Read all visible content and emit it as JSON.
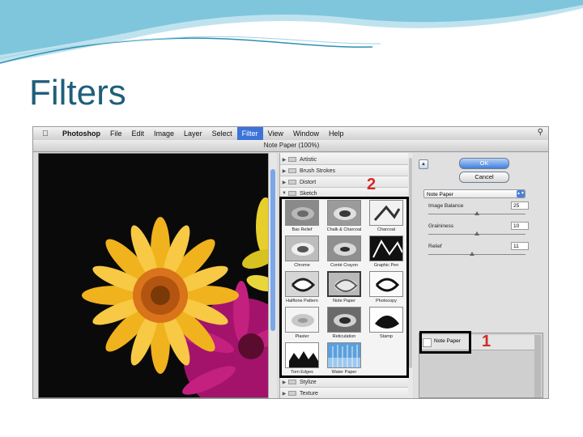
{
  "slide": {
    "title": "Filters"
  },
  "menubar": {
    "items": [
      "Photoshop",
      "File",
      "Edit",
      "Image",
      "Layer",
      "Select",
      "Filter",
      "View",
      "Window",
      "Help"
    ],
    "active": "Filter"
  },
  "dialog": {
    "title": "Note Paper (100%)"
  },
  "gallery": {
    "categories": [
      "Artistic",
      "Brush Strokes",
      "Distort",
      "Sketch",
      "Stylize",
      "Texture"
    ],
    "thumbnails": [
      "Bas Relief",
      "Chalk & Charcoal",
      "Charcoal",
      "Chrome",
      "Conté Crayon",
      "Graphic Pen",
      "Halftone Pattern",
      "Note Paper",
      "Photocopy",
      "Plaster",
      "Reticulation",
      "Stamp",
      "Torn Edges",
      "Water Paper"
    ],
    "selected": "Note Paper"
  },
  "settings": {
    "ok": "OK",
    "cancel": "Cancel",
    "filter": "Note Paper",
    "params": [
      {
        "label": "Image Balance",
        "value": "25",
        "fraction": 0.5
      },
      {
        "label": "Graininess",
        "value": "10",
        "fraction": 0.5
      },
      {
        "label": "Relief",
        "value": "11",
        "fraction": 0.45
      }
    ]
  },
  "layers": {
    "item": "Note Paper"
  },
  "annotations": {
    "one": "1",
    "two": "2"
  },
  "colors": {
    "menu_highlight": "#3b73d9",
    "title": "#1f5f7a",
    "annotation": "#d12a2a"
  }
}
